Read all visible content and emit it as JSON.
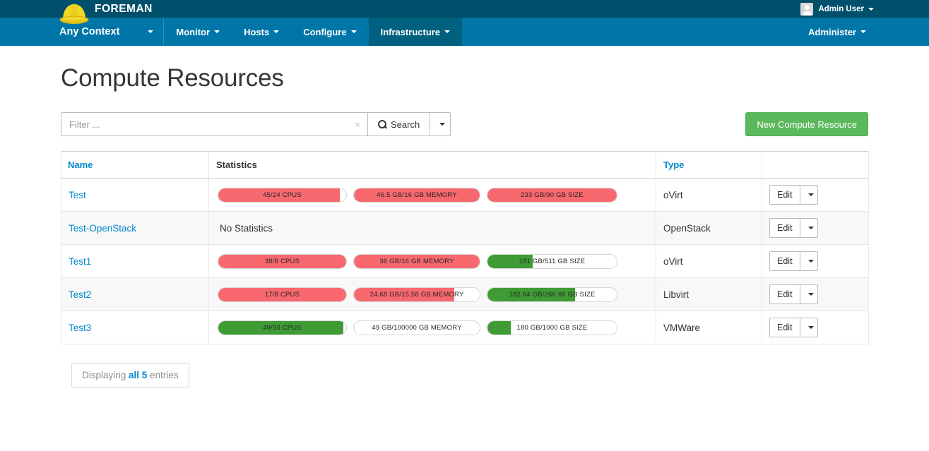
{
  "topbar": {
    "brand": "FOREMAN",
    "logo_icon": "hardhat-icon",
    "user": {
      "name": "Admin User",
      "avatar_icon": "user-avatar-icon",
      "caret_icon": "caret-down-icon"
    }
  },
  "nav": {
    "context": {
      "label": "Any Context",
      "caret_icon": "caret-down-icon"
    },
    "items": [
      {
        "label": "Monitor",
        "active": false
      },
      {
        "label": "Hosts",
        "active": false
      },
      {
        "label": "Configure",
        "active": false
      },
      {
        "label": "Infrastructure",
        "active": true
      }
    ],
    "right": [
      {
        "label": "Administer",
        "active": false
      }
    ]
  },
  "page": {
    "title": "Compute Resources"
  },
  "toolbar": {
    "filter_placeholder": "Filter ...",
    "filter_value": "",
    "filter_clear_icon": "clear-icon",
    "clear_glyph": "×",
    "search_label": "Search",
    "search_icon": "search-icon",
    "search_dropdown_icon": "caret-down-icon",
    "new_label": "New Compute Resource"
  },
  "table": {
    "headers": {
      "name": "Name",
      "statistics": "Statistics",
      "type": "Type",
      "actions": ""
    },
    "rows": [
      {
        "name": "Test",
        "type": "oVirt",
        "has_stats": true,
        "bars": [
          {
            "label": "45/24 CPUS",
            "percent": 95,
            "color": "#f8686f",
            "kind": "cpu"
          },
          {
            "label": "46.5 GB/16 GB MEMORY",
            "percent": 100,
            "color": "#f8686f",
            "kind": "memory"
          },
          {
            "label": "233 GB/90 GB SIZE",
            "percent": 100,
            "color": "#f8686f",
            "kind": "size"
          }
        ],
        "edit_label": "Edit",
        "edit_caret_icon": "caret-down-icon"
      },
      {
        "name": "Test-OpenStack",
        "type": "OpenStack",
        "has_stats": false,
        "no_stats_text": "No Statistics",
        "bars": [],
        "edit_label": "Edit",
        "edit_caret_icon": "caret-down-icon"
      },
      {
        "name": "Test1",
        "type": "oVirt",
        "has_stats": true,
        "bars": [
          {
            "label": "38/8 CPUS",
            "percent": 100,
            "color": "#f8686f",
            "kind": "cpu"
          },
          {
            "label": "36 GB/16 GB MEMORY",
            "percent": 100,
            "color": "#f8686f",
            "kind": "memory"
          },
          {
            "label": "181 GB/511 GB SIZE",
            "percent": 35,
            "color": "#3f9c35",
            "kind": "size"
          }
        ],
        "edit_label": "Edit",
        "edit_caret_icon": "caret-down-icon"
      },
      {
        "name": "Test2",
        "type": "Libvirt",
        "has_stats": true,
        "bars": [
          {
            "label": "17/8 CPUS",
            "percent": 100,
            "color": "#f8686f",
            "kind": "cpu"
          },
          {
            "label": "24.68 GB/15.58 GB MEMORY",
            "percent": 80,
            "color": "#f8686f",
            "kind": "memory"
          },
          {
            "label": "182.64 GB/266.69 GB SIZE",
            "percent": 68,
            "color": "#3f9c35",
            "kind": "size"
          }
        ],
        "edit_label": "Edit",
        "edit_caret_icon": "caret-down-icon"
      },
      {
        "name": "Test3",
        "type": "VMWare",
        "has_stats": true,
        "bars": [
          {
            "label": "49/50 CPUS",
            "percent": 98,
            "color": "#3f9c35",
            "kind": "cpu"
          },
          {
            "label": "49 GB/100000 GB MEMORY",
            "percent": 0,
            "color": "#3f9c35",
            "kind": "memory"
          },
          {
            "label": "180 GB/1000 GB SIZE",
            "percent": 18,
            "color": "#3f9c35",
            "kind": "size"
          }
        ],
        "edit_label": "Edit",
        "edit_caret_icon": "caret-down-icon"
      }
    ]
  },
  "footer": {
    "pager_prefix": "Displaying ",
    "pager_strong": "all 5",
    "pager_suffix": " entries"
  },
  "colors": {
    "topbar": "#00506b",
    "navbar": "#0076a8",
    "nav_active": "#00607f",
    "link": "#0088ce",
    "danger": "#f8686f",
    "success": "#3f9c35",
    "primary_button": "#5cb85c"
  }
}
